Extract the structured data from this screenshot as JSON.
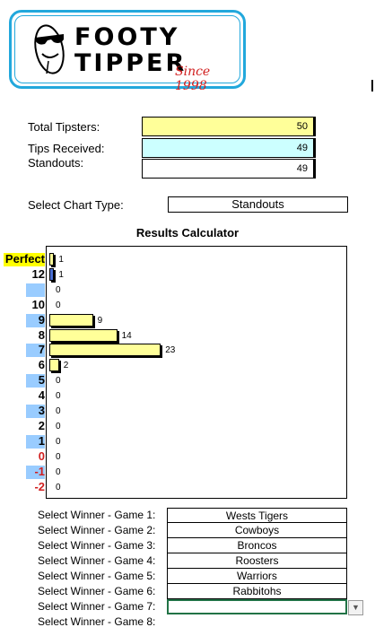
{
  "logo": {
    "line1": "FOOTY",
    "line2": "TIPPER",
    "since": "Since 1998",
    "mascot_icon": "sunglasses-football-icon"
  },
  "stats": [
    {
      "label": "Total Tipsters:",
      "value": "50",
      "bg": "#ffff99"
    },
    {
      "label": "Tips Received:",
      "value": "49",
      "bg": "#ccffff"
    },
    {
      "label": "Standouts:",
      "value": "49",
      "bg": "#ffffff"
    }
  ],
  "chart_type": {
    "label": "Select Chart Type:",
    "value": "Standouts"
  },
  "results_title": "Results Calculator",
  "chart_data": {
    "type": "bar",
    "orientation": "horizontal",
    "categories": [
      "Perfect",
      "12",
      "",
      "10",
      "9",
      "8",
      "7",
      "6",
      "5",
      "4",
      "3",
      "2",
      "1",
      "0",
      "-1",
      "-2"
    ],
    "values": [
      1,
      1,
      0,
      0,
      9,
      14,
      23,
      2,
      0,
      0,
      0,
      0,
      0,
      0,
      0,
      0
    ],
    "bar_colors": [
      "#ffff99",
      "#4a6fd4",
      "#ffff99",
      "#ffff99",
      "#ffff99",
      "#ffff99",
      "#ffff99",
      "#ffff99",
      "#ffff99",
      "#ffff99",
      "#ffff99",
      "#ffff99",
      "#ffff99",
      "#ffff99",
      "#ffff99",
      "#ffff99"
    ],
    "label_bg": [
      "#ffff00",
      "",
      "#99ccff",
      "",
      "#99ccff",
      "",
      "#99ccff",
      "",
      "#99ccff",
      "",
      "#99ccff",
      "",
      "#99ccff",
      "",
      "#99ccff",
      ""
    ],
    "label_color": [
      "#000000",
      "#000000",
      "#000000",
      "#000000",
      "#000000",
      "#000000",
      "#000000",
      "#000000",
      "#000000",
      "#000000",
      "#000000",
      "#000000",
      "#000000",
      "#d11f1f",
      "#d11f1f",
      "#d11f1f"
    ],
    "xlim": [
      0,
      23
    ],
    "grid": false
  },
  "winners": [
    {
      "label": "Select Winner - Game 1:",
      "value": "Wests Tigers"
    },
    {
      "label": "Select Winner - Game 2:",
      "value": "Cowboys"
    },
    {
      "label": "Select Winner - Game 3:",
      "value": "Broncos"
    },
    {
      "label": "Select Winner - Game 4:",
      "value": "Roosters"
    },
    {
      "label": "Select Winner - Game 5:",
      "value": "Warriors"
    },
    {
      "label": "Select Winner - Game 6:",
      "value": "Rabbitohs"
    },
    {
      "label": "Select Winner - Game 7:",
      "value": ""
    },
    {
      "label": "Select Winner - Game 8:",
      "value": ""
    }
  ],
  "dropdown_icon": "chevron-down-icon"
}
